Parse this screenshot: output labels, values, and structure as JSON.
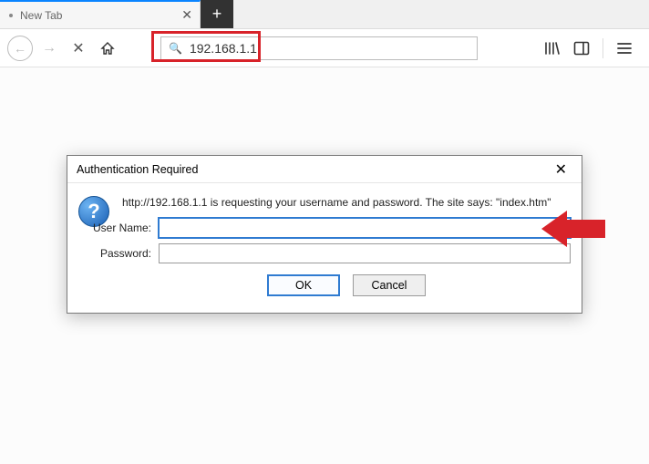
{
  "tab": {
    "title": "New Tab"
  },
  "address": {
    "value": "192.168.1.1"
  },
  "dialog": {
    "title": "Authentication Required",
    "message": "http://192.168.1.1 is requesting your username and password. The site says: \"index.htm\"",
    "username_label": "User Name:",
    "password_label": "Password:",
    "username_value": "",
    "password_value": "",
    "ok_label": "OK",
    "cancel_label": "Cancel"
  }
}
